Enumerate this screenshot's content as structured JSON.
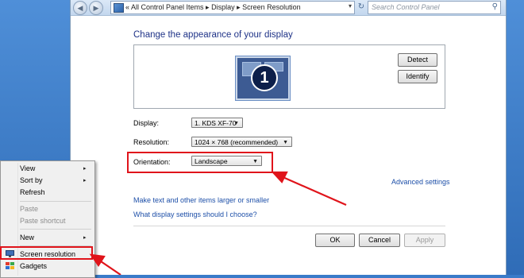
{
  "address_bar": {
    "path": "«  All Control Panel Items  ▸  Display  ▸  Screen Resolution",
    "search_placeholder": "Search Control Panel"
  },
  "nav": {
    "back": "◀",
    "forward": "▶",
    "refresh": "↻",
    "search_icon": "⚲",
    "dropdown": "▾"
  },
  "main": {
    "heading": "Change the appearance of your display",
    "monitor_number": "1",
    "detect_label": "Detect",
    "identify_label": "Identify",
    "display_label": "Display:",
    "display_value": "1. KDS XF-70",
    "resolution_label": "Resolution:",
    "resolution_value": "1024 × 768 (recommended)",
    "orientation_label": "Orientation:",
    "orientation_value": "Landscape",
    "advanced_link": "Advanced settings",
    "link_text_size": "Make text and other items larger or smaller",
    "link_display_settings": "What display settings should I choose?",
    "ok_label": "OK",
    "cancel_label": "Cancel",
    "apply_label": "Apply"
  },
  "context_menu": {
    "items": [
      "View",
      "Sort by",
      "Refresh",
      "Paste",
      "Paste shortcut",
      "New",
      "Screen resolution",
      "Gadgets"
    ],
    "submenu_arrow": "▸"
  },
  "colors": {
    "highlight": "#e0141b",
    "link": "#1d4fa8",
    "heading": "#1e3287"
  }
}
